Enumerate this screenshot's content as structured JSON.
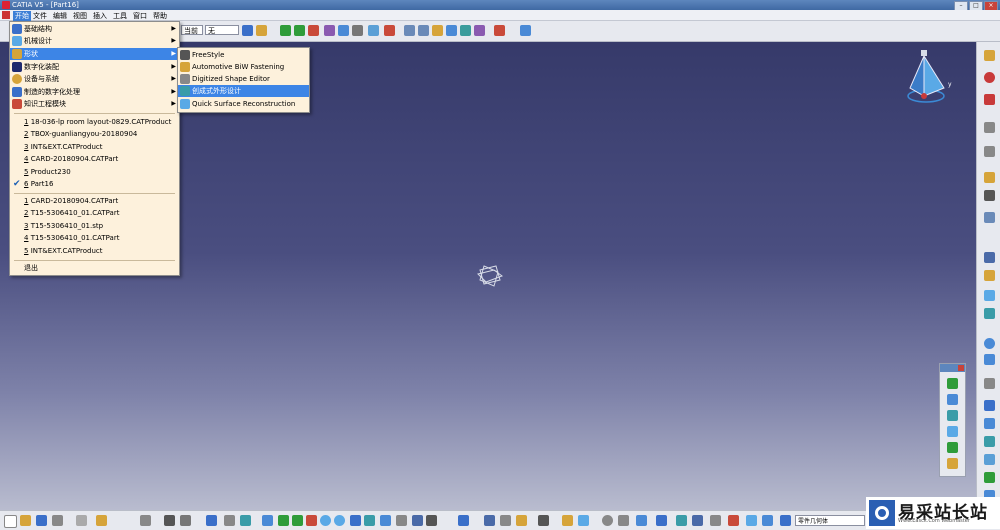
{
  "window": {
    "title": "CATIA V5 - [Part16]"
  },
  "menubar": {
    "items": [
      {
        "label": "开始",
        "active": true
      },
      {
        "label": "文件"
      },
      {
        "label": "编辑"
      },
      {
        "label": "视图"
      },
      {
        "label": "插入"
      },
      {
        "label": "工具"
      },
      {
        "label": "窗口"
      },
      {
        "label": "帮助"
      }
    ]
  },
  "toolbar": {
    "combo1": "当前",
    "combo2": "无"
  },
  "start_menu": {
    "items": [
      {
        "label": "基础结构",
        "submenu": true
      },
      {
        "label": "机械设计",
        "submenu": true
      },
      {
        "label": "形状",
        "submenu": true,
        "highlighted": true
      },
      {
        "label": "数字化装配",
        "submenu": true
      },
      {
        "label": "设备与系统",
        "submenu": true
      },
      {
        "label": "制造的数字化处理",
        "submenu": true
      },
      {
        "label": "知识工程模块",
        "submenu": true
      }
    ],
    "recent_files": [
      {
        "num": "1",
        "label": "18-036-lp room layout-0829.CATProduct"
      },
      {
        "num": "2",
        "label": "TBOX-guanliangyou-20180904"
      },
      {
        "num": "3",
        "label": "INT&EXT.CATProduct"
      },
      {
        "num": "4",
        "label": "CARD-20180904.CATPart"
      },
      {
        "num": "5",
        "label": "Product230"
      },
      {
        "num": "6",
        "label": "Part16",
        "checked": true
      }
    ],
    "recent_docs": [
      {
        "num": "1",
        "label": "CARD-20180904.CATPart"
      },
      {
        "num": "2",
        "label": "T15-5306410_01.CATPart"
      },
      {
        "num": "3",
        "label": "T15-5306410_01.stp"
      },
      {
        "num": "4",
        "label": "T15-5306410_01.CATPart"
      },
      {
        "num": "5",
        "label": "INT&EXT.CATProduct"
      }
    ],
    "exit_label": "退出"
  },
  "shape_submenu": {
    "items": [
      {
        "label": "FreeStyle"
      },
      {
        "label": "Automotive BiW Fastening"
      },
      {
        "label": "Digitized Shape Editor"
      },
      {
        "label": "创成式外形设计",
        "highlighted": true
      },
      {
        "label": "Quick Surface Reconstruction"
      }
    ]
  },
  "status": {
    "field": "零件几何体"
  },
  "watermark": {
    "text": "易采站长站",
    "sub": "Www.Easck.Com  Webmaster"
  },
  "colors": {
    "highlight": "#3d85e6",
    "menu_bg": "#fdf1dc",
    "viewport_top": "#363a6a",
    "viewport_bottom": "#b9bccf"
  }
}
